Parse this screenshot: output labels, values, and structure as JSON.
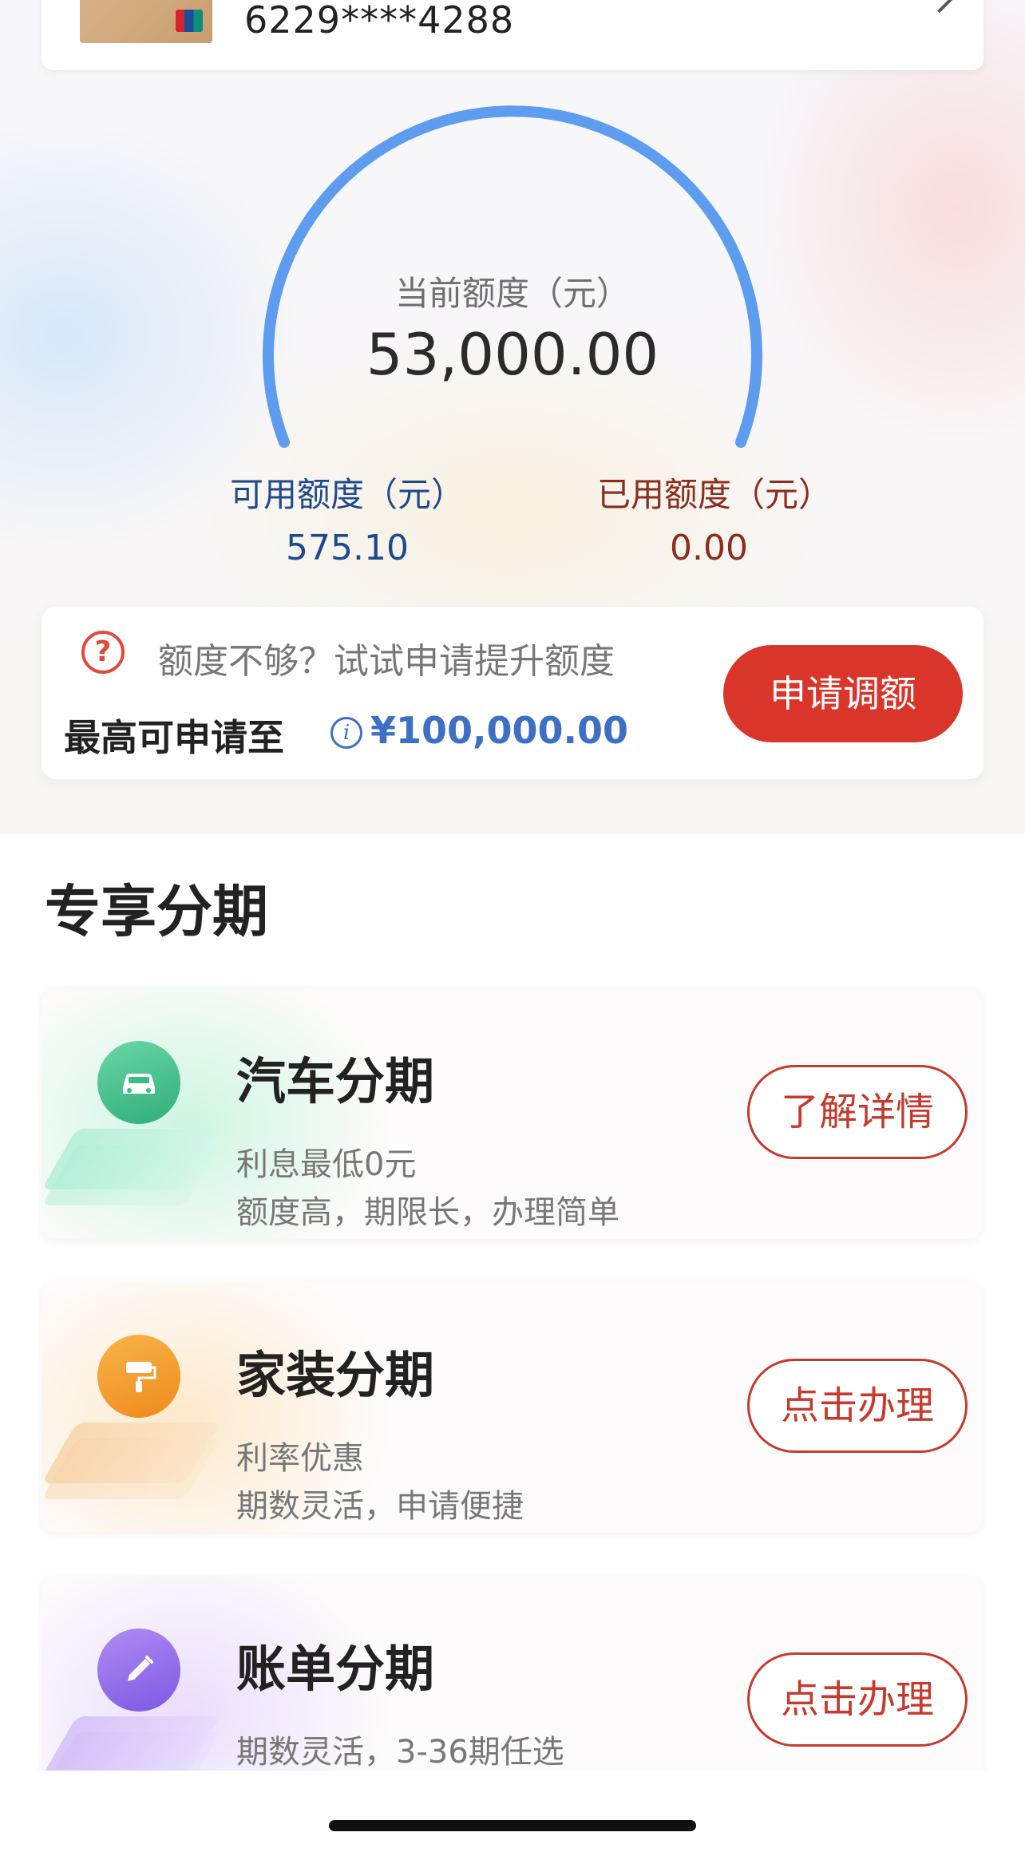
{
  "card": {
    "number": "6229****4288"
  },
  "quota": {
    "title": "当前额度（元）",
    "value": "53,000.00",
    "available_label": "可用额度（元）",
    "available_value": "575.10",
    "used_label": "已用额度（元）",
    "used_value": "0.00",
    "arc_color": "#5e9cf0"
  },
  "raise": {
    "hint": "额度不够？试试申请提升额度",
    "max_label": "最高可申请至",
    "max_amount": "¥100,000.00",
    "button": "申请调额",
    "button_color": "#d9352a"
  },
  "section": {
    "title": "专享分期"
  },
  "products": [
    {
      "icon": "car-icon",
      "title": "汽车分期",
      "line1": "利息最低0元",
      "line2": "额度高，期限长，办理简单",
      "button": "了解详情"
    },
    {
      "icon": "paint-roller-icon",
      "title": "家装分期",
      "line1": "利率优惠",
      "line2": "期数灵活，申请便捷",
      "button": "点击办理"
    },
    {
      "icon": "pencil-icon",
      "title": "账单分期",
      "line1": "期数灵活，3-36期任选",
      "button": "点击办理"
    }
  ]
}
